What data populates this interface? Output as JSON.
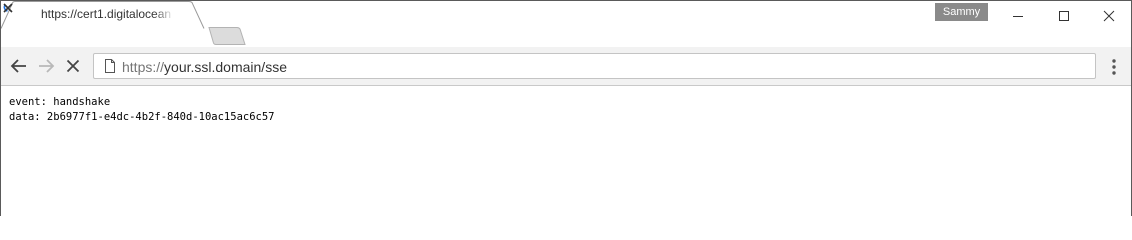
{
  "window": {
    "profile_name": "Sammy"
  },
  "tab": {
    "title": "https://cert1.digitalocean",
    "icon": "loading-spinner-icon",
    "close_icon": "close-icon"
  },
  "toolbar": {
    "back_icon": "arrow-left-icon",
    "forward_icon": "arrow-right-icon",
    "stop_icon": "close-icon",
    "menu_icon": "vertical-dots-icon",
    "url_scheme": "https://",
    "url_rest": "your.ssl.domain/sse"
  },
  "content": {
    "lines": [
      "event: handshake",
      "data: 2b6977f1-e4dc-4b2f-840d-10ac15ac6c57"
    ]
  },
  "colors": {
    "spinner_blue": "#1a73e8",
    "profile_badge": "#8a8a8a",
    "toolbar_bg": "#f2f2f2"
  }
}
